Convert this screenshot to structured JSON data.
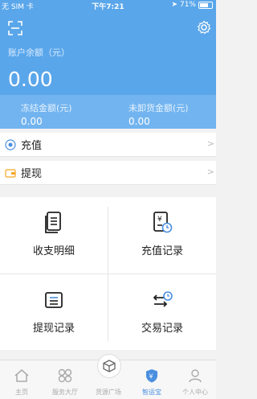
{
  "status_bar": {
    "carrier": "无 SIM 卡",
    "time": "下午7:21",
    "battery": "71%",
    "battery_level": 0.71
  },
  "account": {
    "balance_label": "账户余额（元）",
    "balance_value": "0.00",
    "frozen_label": "冻结金额(元)",
    "frozen_value": "0.00",
    "unloaded_label": "未卸货金额(元)",
    "unloaded_value": "0.00"
  },
  "actions": [
    {
      "label": "充值",
      "icon": "recharge-icon"
    },
    {
      "label": "提现",
      "icon": "wallet-icon"
    }
  ],
  "grid": [
    {
      "label": "收支明细",
      "icon": "document-icon"
    },
    {
      "label": "充值记录",
      "icon": "recharge-record-icon"
    },
    {
      "label": "提现记录",
      "icon": "withdraw-record-icon"
    },
    {
      "label": "交易记录",
      "icon": "transaction-icon"
    }
  ],
  "tabs": [
    {
      "label": "主页",
      "icon": "home-icon",
      "active": false
    },
    {
      "label": "服务大厅",
      "icon": "services-icon",
      "active": false
    },
    {
      "label": "货源广场",
      "icon": "cargo-icon",
      "active": false
    },
    {
      "label": "智运宝",
      "icon": "shield-icon",
      "active": true
    },
    {
      "label": "个人中心",
      "icon": "person-icon",
      "active": false
    }
  ],
  "colors": {
    "header": "#5aa6ea",
    "subheader": "#72b4ef",
    "accent": "#4a8fe0",
    "icon_orange": "#f5a623"
  }
}
